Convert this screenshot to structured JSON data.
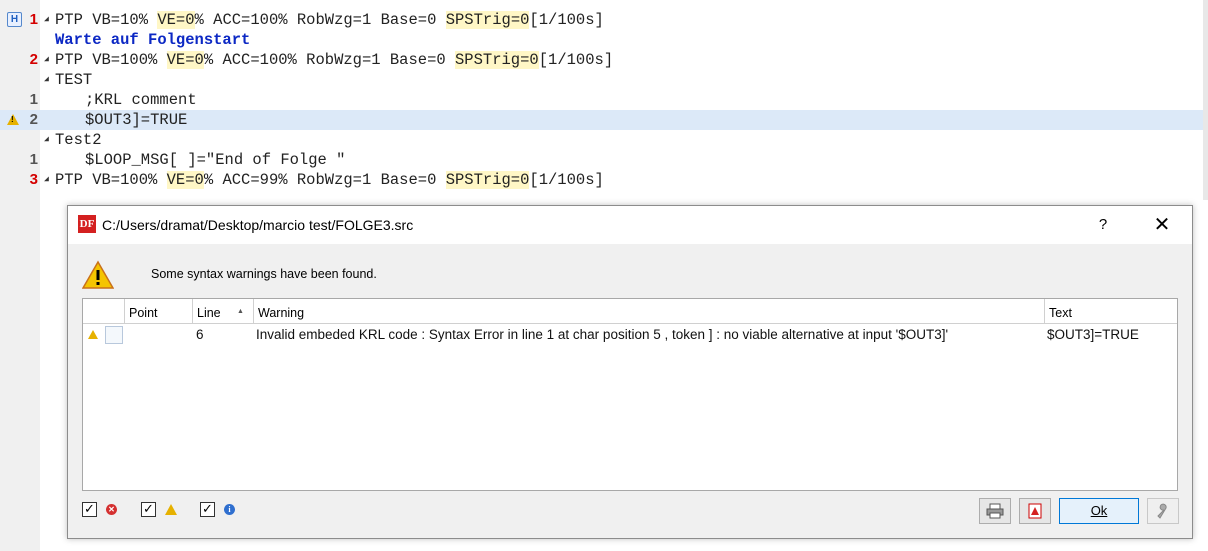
{
  "editor": {
    "lines": [
      {
        "num": "1",
        "fold": true,
        "segments": [
          {
            "t": "PTP VB=10% ",
            "s": ""
          },
          {
            "t": "VE=0",
            "s": "yel"
          },
          {
            "t": "% ACC=100% RobWzg=1 Base=0 ",
            "s": ""
          },
          {
            "t": "SPSTrig=0",
            "s": "yel"
          },
          {
            "t": "[1/100s]",
            "s": ""
          }
        ]
      },
      {
        "num": "",
        "fold": false,
        "segments": [
          {
            "t": "Warte auf Folgenstart",
            "s": "blue"
          }
        ]
      },
      {
        "num": "2",
        "fold": true,
        "segments": [
          {
            "t": "PTP VB=100% ",
            "s": ""
          },
          {
            "t": "VE=0",
            "s": "yel"
          },
          {
            "t": "% ACC=100% RobWzg=1 Base=0 ",
            "s": ""
          },
          {
            "t": "SPSTrig=0",
            "s": "yel"
          },
          {
            "t": "[1/100s]",
            "s": ""
          }
        ]
      },
      {
        "num": "",
        "fold": true,
        "segments": [
          {
            "t": "TEST",
            "s": ""
          }
        ]
      },
      {
        "num": "1",
        "fold": false,
        "segments": [
          {
            "t": ";KRL comment",
            "s": ""
          }
        ]
      },
      {
        "num": "2",
        "fold": false,
        "segments": [
          {
            "t": "$OUT3]=TRUE",
            "s": ""
          }
        ]
      },
      {
        "num": "",
        "fold": true,
        "segments": [
          {
            "t": "Test2",
            "s": ""
          }
        ]
      },
      {
        "num": "1",
        "fold": false,
        "segments": [
          {
            "t": "$LOOP_MSG[ ]=\"End of Folge \"",
            "s": ""
          }
        ]
      },
      {
        "num": "3",
        "fold": true,
        "segments": [
          {
            "t": "PTP VB=100% ",
            "s": ""
          },
          {
            "t": "VE=0",
            "s": "yel"
          },
          {
            "t": "% ACC=99% RobWzg=1 Base=0 ",
            "s": ""
          },
          {
            "t": "SPSTrig=0",
            "s": "yel"
          },
          {
            "t": "[1/100s]",
            "s": ""
          }
        ]
      }
    ]
  },
  "dialog": {
    "title": "C:/Users/dramat/Desktop/marcio test/FOLGE3.src",
    "app_icon_text": "DF",
    "help_label": "?",
    "close_label": "✕",
    "message": "Some syntax warnings have been found.",
    "columns": {
      "point": "Point",
      "line": "Line",
      "warning": "Warning",
      "text": "Text"
    },
    "rows": [
      {
        "line": "6",
        "warning": "Invalid embeded KRL code : Syntax Error in line 1 at char position 5 , token ] : no viable alternative at input '$OUT3]'",
        "text": "$OUT3]=TRUE"
      }
    ],
    "filters": {
      "errors_checked": "✓",
      "warnings_checked": "✓",
      "info_checked": "✓"
    },
    "ok_label": "Ok"
  }
}
